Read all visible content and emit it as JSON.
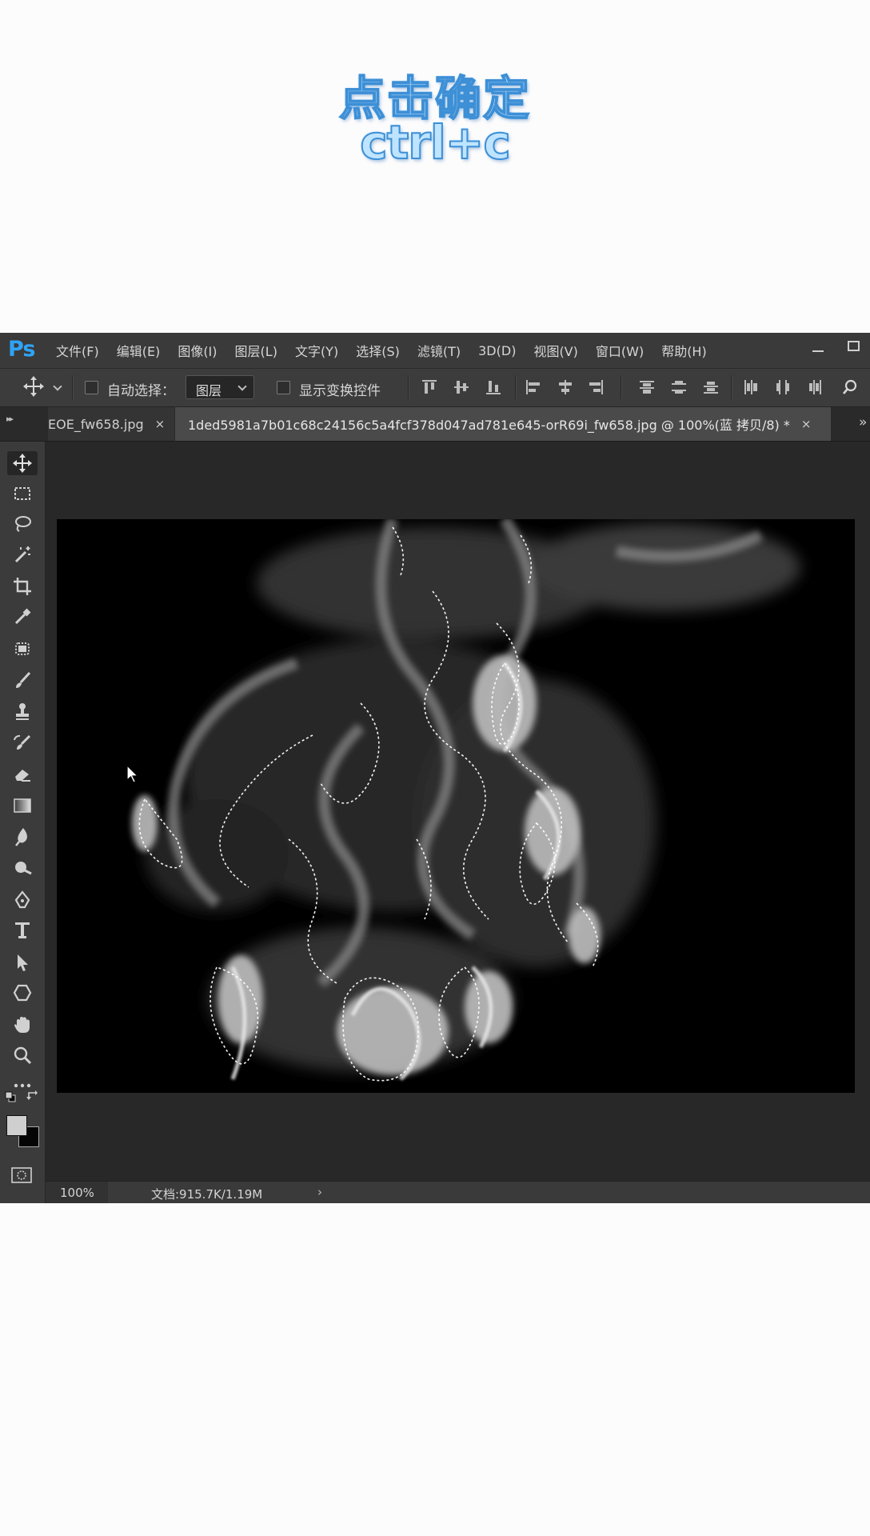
{
  "caption": {
    "line1": "点击确定",
    "line2": "ctrl+c"
  },
  "app": {
    "logo": "Ps",
    "menu": [
      "文件(F)",
      "编辑(E)",
      "图像(I)",
      "图层(L)",
      "文字(Y)",
      "选择(S)",
      "滤镜(T)",
      "3D(D)",
      "视图(V)",
      "窗口(W)",
      "帮助(H)"
    ]
  },
  "options_bar": {
    "auto_select_label": "自动选择：",
    "auto_select_target": "图层",
    "show_transform_label": "显示变换控件"
  },
  "tabs": {
    "tab1_label": "EOE_fw658.jpg",
    "tab2_label": "1ded5981a7b01c68c24156c5a4fcf378d047ad781e645-orR69i_fw658.jpg @ 100%(蓝 拷贝/8) *",
    "close_glyph": "×",
    "more_glyph": "»",
    "collapse_glyph": "▸▸"
  },
  "status": {
    "zoom": "100%",
    "doc_info": "文档:915.7K/1.19M",
    "arrow": "›"
  },
  "colors": {
    "accent": "#2fa3f6",
    "panel": "#3b3b3b",
    "workspace": "#282828",
    "caption_fill": "#bfe4ff",
    "caption_stroke": "#3d8fd6"
  }
}
